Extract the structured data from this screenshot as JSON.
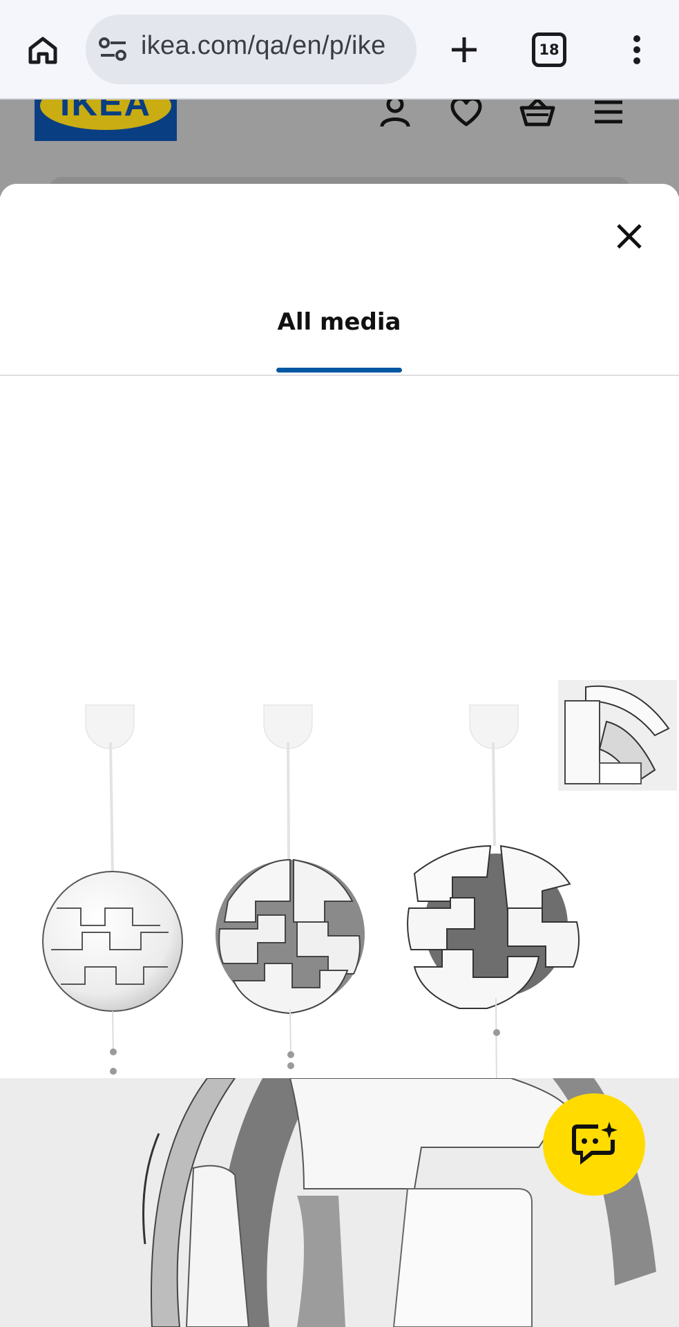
{
  "browser": {
    "url": "ikea.com/qa/en/p/ike",
    "tab_count": "18",
    "icons": {
      "home": "home-icon",
      "site_settings": "tune-icon",
      "new_tab": "plus-icon",
      "tabs": "tab-switcher-icon",
      "menu": "more-vert-icon"
    }
  },
  "site_header": {
    "logo_text": "IKEA",
    "icons": [
      "person-icon",
      "heart-icon",
      "basket-icon",
      "hamburger-icon"
    ],
    "colors": {
      "logo_blue": "#0a3e82",
      "logo_yellow": "#c9ad12"
    }
  },
  "modal": {
    "close_icon": "close-icon",
    "tabs": [
      {
        "label": "All media",
        "selected": true
      }
    ],
    "accent": "#0058a3",
    "media": [
      {
        "kind": "main-image",
        "depicts": "lamp-variants"
      },
      {
        "kind": "thumbnail",
        "depicts": "lamp-detail"
      },
      {
        "kind": "closeup-image",
        "depicts": "lamp-closeup"
      }
    ]
  },
  "assistant": {
    "icon": "sparkle-chat-icon",
    "color": "#ffdb00"
  }
}
